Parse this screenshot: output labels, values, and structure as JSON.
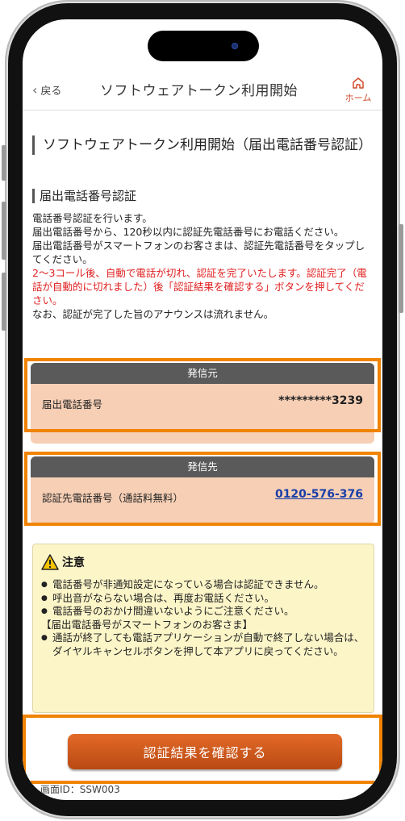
{
  "header": {
    "back_label": "戻る",
    "title": "ソフトウェアトークン利用開始",
    "home_label": "ホーム"
  },
  "page_heading": "ソフトウェアトークン利用開始（届出電話番号認証）",
  "section_heading": "届出電話番号認証",
  "description": {
    "line1": "電話番号認証を行います。",
    "line2": "届出電話番号から、120秒以内に認証先電話番号にお電話ください。",
    "line3": "届出電話番号がスマートフォンのお客さまは、認証先電話番号をタップしてください。",
    "warning": "2～3コール後、自動で電話が切れ、認証を完了いたします。認証完了（電話が自動的に切れました）後「認証結果を確認する」ボタンを押してください。",
    "line5": "なお、認証が完了した旨のアナウンスは流れません。"
  },
  "caller": {
    "header": "発信元",
    "label": "届出電話番号",
    "value": "*********3239"
  },
  "callee": {
    "header": "発信先",
    "label": "認証先電話番号（通話料無料）",
    "value": "0120-576-376"
  },
  "notice": {
    "title": "注意",
    "items": [
      "電話番号が非通知設定になっている場合は認証できません。",
      "呼出音がならない場合は、再度お電話ください。",
      "電話番号のおかけ間違いないようにご注意ください。"
    ],
    "subheading": "【届出電話番号がスマートフォンのお客さま】",
    "sub_items": [
      "通話が終了しても電話アプリケーションが自動で終了しない場合は、ダイヤルキャンセルボタンを押して本アプリに戻ってください。"
    ]
  },
  "confirm_button": "認証結果を確認する",
  "screen_id": "画面ID：SSW003",
  "colors": {
    "highlight": "#f08300",
    "box_fill": "#f6cfb5",
    "box_header": "#5a5a5a",
    "warning_text": "#e02020",
    "notice_bg": "#fcf5c8",
    "button": "#c9531a",
    "link": "#1a3fa8"
  }
}
